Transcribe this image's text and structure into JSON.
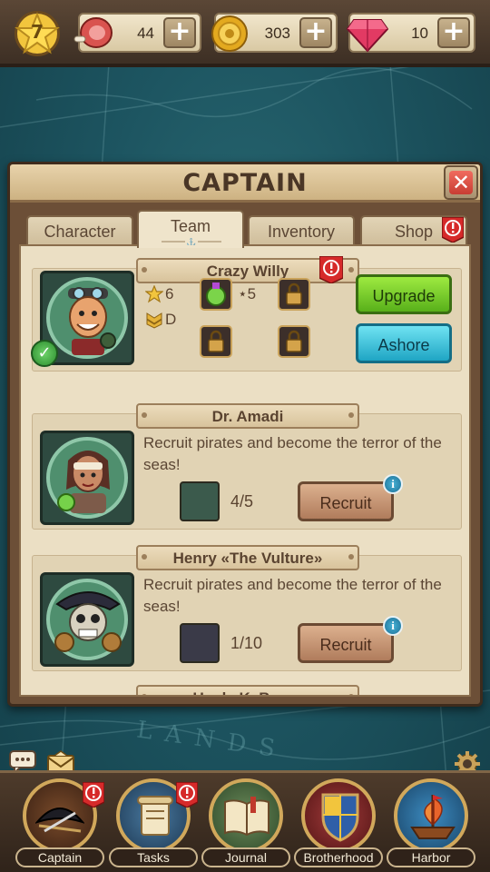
{
  "topbar": {
    "level": "7",
    "meat": {
      "icon": "meat-icon",
      "value": "44",
      "add_label": "+"
    },
    "gold": {
      "icon": "gold-coin-icon",
      "value": "303",
      "add_label": "+"
    },
    "gems": {
      "icon": "red-gem-icon",
      "value": "10",
      "add_label": "+"
    }
  },
  "map": {
    "text": "LANDS"
  },
  "panel": {
    "title": "CAPTAIN",
    "close_label": "✕",
    "tabs": [
      {
        "label": "Character",
        "active": false
      },
      {
        "label": "Team",
        "active": true
      },
      {
        "label": "Inventory",
        "active": false
      },
      {
        "label": "Shop",
        "active": false,
        "alert": true
      }
    ]
  },
  "team": {
    "active_member": {
      "name": "Crazy Willy",
      "stars": "6",
      "rank": "D",
      "item_count": "5",
      "upgrade_label": "Upgrade",
      "ashore_label": "Ashore"
    },
    "recruits": [
      {
        "name": "Dr. Amadi",
        "description": "Recruit pirates and become the terror of the seas!",
        "progress": "4/5",
        "progress_fraction": 0.8,
        "recruit_label": "Recruit"
      },
      {
        "name": "Henry «The Vulture»",
        "description": "Recruit pirates and become the terror of the seas!",
        "progress": "1/10",
        "progress_fraction": 0.1,
        "recruit_label": "Recruit"
      },
      {
        "name": "Uncle KaBoom"
      }
    ]
  },
  "colors": {
    "upgrade": "#58b01a",
    "ashore": "#1fa5c4",
    "alert": "#d62a2a",
    "accent_gold": "#d1a85b"
  },
  "bottom_nav": [
    {
      "label": "Captain",
      "icon": "pirate-hat-icon",
      "alert": true
    },
    {
      "label": "Tasks",
      "icon": "scroll-icon",
      "alert": true
    },
    {
      "label": "Journal",
      "icon": "journal-book-icon",
      "alert": false
    },
    {
      "label": "Brotherhood",
      "icon": "shield-crest-icon",
      "alert": false
    },
    {
      "label": "Harbor",
      "icon": "ship-icon",
      "alert": false
    }
  ]
}
